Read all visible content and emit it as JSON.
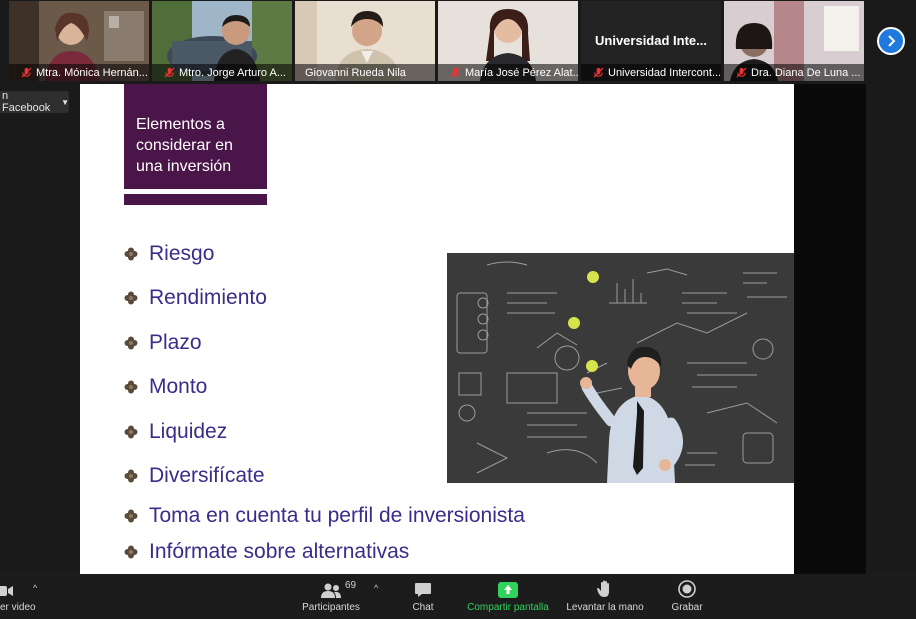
{
  "participants": [
    {
      "name": "Mtra. Mónica Hernán...",
      "muted": true
    },
    {
      "name": "Mtro. Jorge Arturo A...",
      "muted": true
    },
    {
      "name": "Giovanni Rueda Nila",
      "muted": false,
      "active": true
    },
    {
      "name": "María José Pérez Alat...",
      "muted": true
    },
    {
      "name": "Universidad Intercont...",
      "muted": true,
      "org_label": "Universidad  Inte..."
    },
    {
      "name": "Dra. Diana De Luna ...",
      "muted": true
    }
  ],
  "live_label": "n Facebook",
  "slide": {
    "title": "Elementos a considerar en una inversión",
    "bullets": [
      "Riesgo",
      "Rendimiento",
      "Plazo",
      "Monto",
      "Liquidez",
      "Diversifícate",
      "Toma en cuenta tu perfil de inversionista",
      "Infórmate sobre alternativas"
    ]
  },
  "toolbar": {
    "video_label": "er video",
    "participants_label": "Participantes",
    "participants_count": "69",
    "chat_label": "Chat",
    "share_label": "Compartir pantalla",
    "raise_hand_label": "Levantar la mano",
    "record_label": "Grabar"
  },
  "colors": {
    "title_bg": "#4a1548",
    "bullet_text": "#3c2b8a",
    "share_green": "#2fd35c",
    "active_border": "#d8d84a"
  }
}
